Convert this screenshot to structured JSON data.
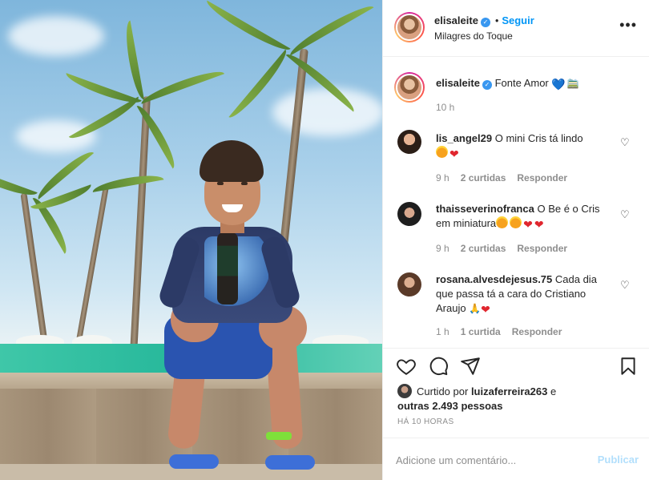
{
  "post_author": {
    "username": "elisaleite",
    "follow_label": "Seguir",
    "dot": "•",
    "location": "Milagres do Toque",
    "verified_mark": "✓"
  },
  "icons": {
    "more": "•••",
    "like": "heart-icon",
    "comment": "comment-icon",
    "share": "share-icon",
    "save": "bookmark-icon",
    "small_heart": "♡"
  },
  "caption": {
    "username": "elisaleite",
    "text": "Fonte Amor",
    "emoji_heart": "💙",
    "emoji_extra": "🚞",
    "time": "10 h"
  },
  "comments": [
    {
      "username": "lis_angel29",
      "text": "O mini Cris tá lindo",
      "time": "9 h",
      "likes": "2 curtidas",
      "reply": "Responder"
    },
    {
      "username": "thaisseverinofranca",
      "text": "O Be é o Cris em miniatura",
      "time": "9 h",
      "likes": "2 curtidas",
      "reply": "Responder"
    },
    {
      "username": "rosana.alvesdejesus.75",
      "text": "Cada dia que passa tá a cara do Cristiano Araujo",
      "time": "1 h",
      "likes": "1 curtida",
      "reply": "Responder"
    }
  ],
  "likes": {
    "prefix": "Curtido por",
    "user": "luizaferreira263",
    "joiner": "e",
    "others": "outras 2.493 pessoas"
  },
  "posted_ago": "HÁ 10 HORAS",
  "add_comment": {
    "placeholder": "Adicione um comentário...",
    "publish_label": "Publicar"
  },
  "colors": {
    "accent": "#0095f6",
    "publish_disabled": "#b2dffc",
    "muted": "#8e8e8e",
    "border": "#efefef"
  }
}
